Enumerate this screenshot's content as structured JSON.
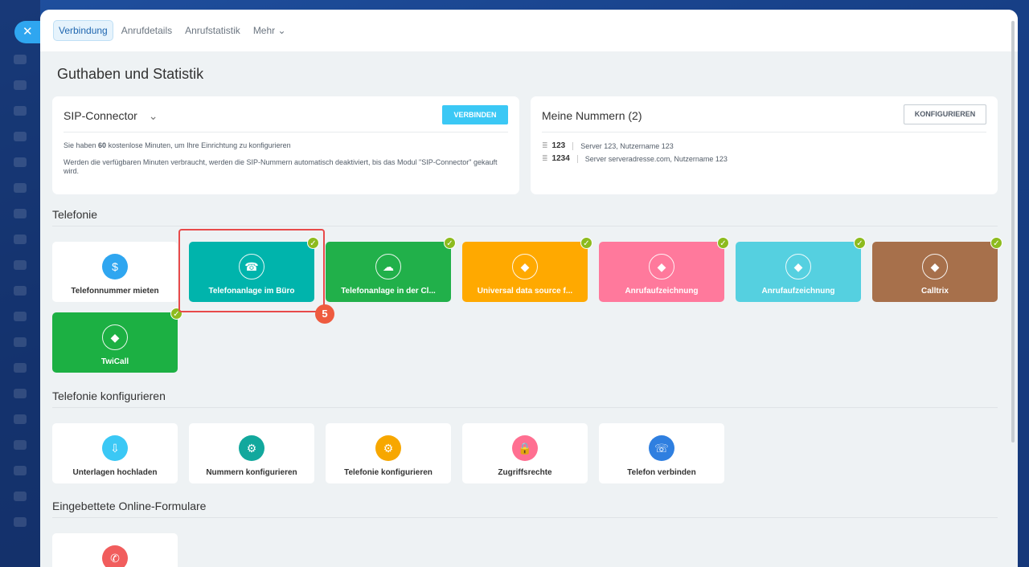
{
  "colors": {
    "teal": "#00b4ac",
    "green": "#21b04a",
    "orange": "#ffa900",
    "pink": "#ff799c",
    "cyan": "#55d0e0",
    "brown": "#a7704b",
    "green2": "#1cb043",
    "accent": "#3bc8f5",
    "check": "#8dbb1e",
    "highlight": "#e84a4a"
  },
  "close": {
    "icon": "close-icon",
    "glyph": "✕"
  },
  "tabs": [
    {
      "label": "Verbindung",
      "active": true
    },
    {
      "label": "Anrufdetails"
    },
    {
      "label": "Anrufstatistik"
    },
    {
      "label": "Mehr ⌄"
    }
  ],
  "page_title": "Guthaben und Statistik",
  "sip": {
    "title": "SIP-Connector",
    "chevron": "⌄",
    "button": "VERBINDEN",
    "line1_prefix": "Sie haben ",
    "line1_bold": "60",
    "line1_suffix": " kostenlose Minuten, um Ihre Einrichtung zu konfigurieren",
    "line2": "Werden die verfügbaren Minuten verbraucht, werden die SIP-Nummern automatisch deaktiviert, bis das Modul \"SIP-Connector\" gekauft wird."
  },
  "numbers": {
    "title": "Meine Nummern (2)",
    "button": "KONFIGURIEREN",
    "rows": [
      {
        "number": "123",
        "detail": "Server 123, Nutzername 123"
      },
      {
        "number": "1234",
        "detail": "Server serveradresse.com, Nutzername 123"
      }
    ]
  },
  "sections": {
    "telefonie": "Telefonie",
    "konfig": "Telefonie konfigurieren",
    "forms": "Eingebettete Online-Formulare"
  },
  "telephony_tiles": [
    {
      "label": "Telefonnummer mieten",
      "icon": "phone-rent-icon",
      "glyph": "$",
      "style": "white",
      "color": "#2fa6f0",
      "checked": false
    },
    {
      "label": "Telefonanlage im Büro",
      "icon": "pbx-office-icon",
      "glyph": "☎",
      "style": "colored",
      "color": "#00b4ac",
      "checked": true
    },
    {
      "label": "Telefonanlage in der Cl...",
      "icon": "pbx-cloud-icon",
      "glyph": "☁",
      "style": "colored",
      "color": "#21b04a",
      "checked": true
    },
    {
      "label": "Universal data source f...",
      "icon": "box-icon",
      "glyph": "◆",
      "style": "colored",
      "color": "#ffa900",
      "checked": true
    },
    {
      "label": "Anrufaufzeichnung",
      "icon": "box-icon",
      "glyph": "◆",
      "style": "colored",
      "color": "#ff799c",
      "checked": true
    },
    {
      "label": "Anrufaufzeichnung",
      "icon": "box-icon",
      "glyph": "◆",
      "style": "colored",
      "color": "#55d0e0",
      "checked": true
    },
    {
      "label": "Calltrix",
      "icon": "box-icon",
      "glyph": "◆",
      "style": "colored",
      "color": "#a7704b",
      "checked": true
    },
    {
      "label": "TwiCall",
      "icon": "box-icon",
      "glyph": "◆",
      "style": "colored",
      "color": "#1cb043",
      "checked": true
    }
  ],
  "config_tiles": [
    {
      "label": "Unterlagen hochladen",
      "icon": "upload-document-icon",
      "glyph": "⇩",
      "color": "#3bc8f5"
    },
    {
      "label": "Nummern konfigurieren",
      "icon": "phone-settings-icon",
      "glyph": "⚙",
      "color": "#12a89d"
    },
    {
      "label": "Telefonie konfigurieren",
      "icon": "telephony-settings-icon",
      "glyph": "⚙",
      "color": "#f7a700"
    },
    {
      "label": "Zugriffsrechte",
      "icon": "access-rights-icon",
      "glyph": "🔒",
      "color": "#ff6f91"
    },
    {
      "label": "Telefon verbinden",
      "icon": "phone-connect-icon",
      "glyph": "☏",
      "color": "#2f7fe0"
    }
  ],
  "form_tiles": [
    {
      "label": "",
      "icon": "phone-form-icon",
      "glyph": "✆",
      "color": "#f15d5d"
    }
  ],
  "step_badge": "5",
  "check_glyph": "✓"
}
